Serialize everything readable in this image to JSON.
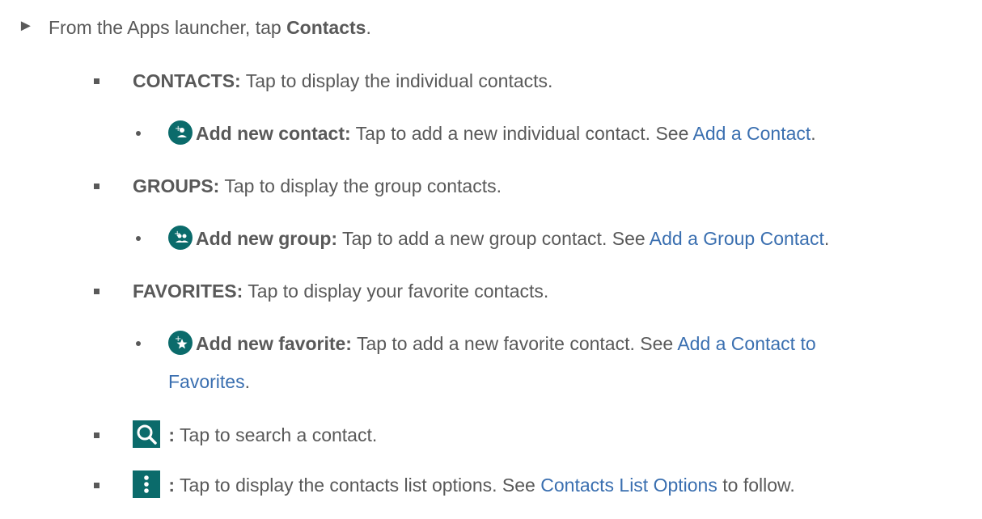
{
  "intro": {
    "prefix": "From the Apps launcher, tap ",
    "bold": "Contacts",
    "suffix": "."
  },
  "items": [
    {
      "term": "CONTACTS:",
      "text": " Tap to display the individual contacts."
    },
    {
      "term": "GROUPS:",
      "text": " Tap to display the group contacts."
    },
    {
      "term": "FAVORITES:",
      "text": " Tap to display your favorite contacts."
    }
  ],
  "subitems": [
    {
      "icon": "add-contact-icon",
      "term": "Add new contact:",
      "text": " Tap to add a new individual contact. See ",
      "link": "Add a Contact",
      "suffix": "."
    },
    {
      "icon": "add-group-icon",
      "term": "Add new group:",
      "text": " Tap to add a new group contact. See ",
      "link": "Add a Group Contact",
      "suffix": "."
    },
    {
      "icon": "add-favorite-icon",
      "term": "Add new favorite:",
      "text": " Tap to add a new favorite contact. See ",
      "link": "Add a Contact to",
      "link_cont": "Favorites",
      "suffix": "."
    }
  ],
  "search_item": {
    "icon": "search-icon",
    "sep": " :",
    "text": " Tap to search a contact."
  },
  "menu_item": {
    "icon": "more-vert-icon",
    "sep": " :",
    "text": " Tap to display the contacts list options. See ",
    "link": "Contacts List Options",
    "suffix": " to follow."
  },
  "colors": {
    "text": "#595959",
    "link": "#3a6fb0",
    "icon_bg": "#0b6b6b"
  }
}
